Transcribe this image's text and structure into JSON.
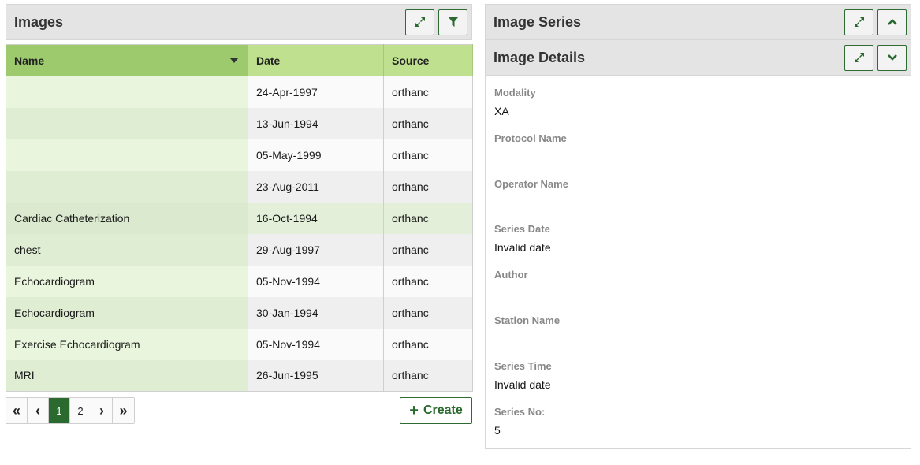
{
  "images_panel": {
    "title": "Images",
    "expand_icon": "expand-icon",
    "filter_icon": "filter-icon",
    "columns": [
      "Name",
      "Date",
      "Source"
    ],
    "rows": [
      {
        "name": "",
        "date": "24-Apr-1997",
        "source": "orthanc"
      },
      {
        "name": "",
        "date": "13-Jun-1994",
        "source": "orthanc"
      },
      {
        "name": "",
        "date": "05-May-1999",
        "source": "orthanc"
      },
      {
        "name": "",
        "date": "23-Aug-2011",
        "source": "orthanc"
      },
      {
        "name": "Cardiac Catheterization",
        "date": "16-Oct-1994",
        "source": "orthanc"
      },
      {
        "name": "chest",
        "date": "29-Aug-1997",
        "source": "orthanc"
      },
      {
        "name": "Echocardiogram",
        "date": "05-Nov-1994",
        "source": "orthanc"
      },
      {
        "name": "Echocardiogram",
        "date": "30-Jan-1994",
        "source": "orthanc"
      },
      {
        "name": "Exercise Echocardiogram",
        "date": "05-Nov-1994",
        "source": "orthanc"
      },
      {
        "name": "MRI",
        "date": "26-Jun-1995",
        "source": "orthanc"
      }
    ],
    "pager": {
      "first": "«",
      "prev": "‹",
      "pages": [
        "1",
        "2"
      ],
      "next": "›",
      "last": "»",
      "current": "1"
    },
    "create_label": "Create",
    "create_icon": "+"
  },
  "series_panel": {
    "title": "Image Series"
  },
  "details_panel": {
    "title": "Image Details",
    "fields": [
      {
        "label": "Modality",
        "value": "XA"
      },
      {
        "label": "Protocol Name",
        "value": ""
      },
      {
        "label": "Operator Name",
        "value": ""
      },
      {
        "label": "Series Date",
        "value": "Invalid date"
      },
      {
        "label": "Author",
        "value": ""
      },
      {
        "label": "Station Name",
        "value": ""
      },
      {
        "label": "Series Time",
        "value": "Invalid date"
      },
      {
        "label": "Series No:",
        "value": "5"
      }
    ]
  },
  "colors": {
    "accent": "#2a6a2f",
    "header_green": "#bfe08e",
    "sorted_green": "#9cca6c"
  }
}
